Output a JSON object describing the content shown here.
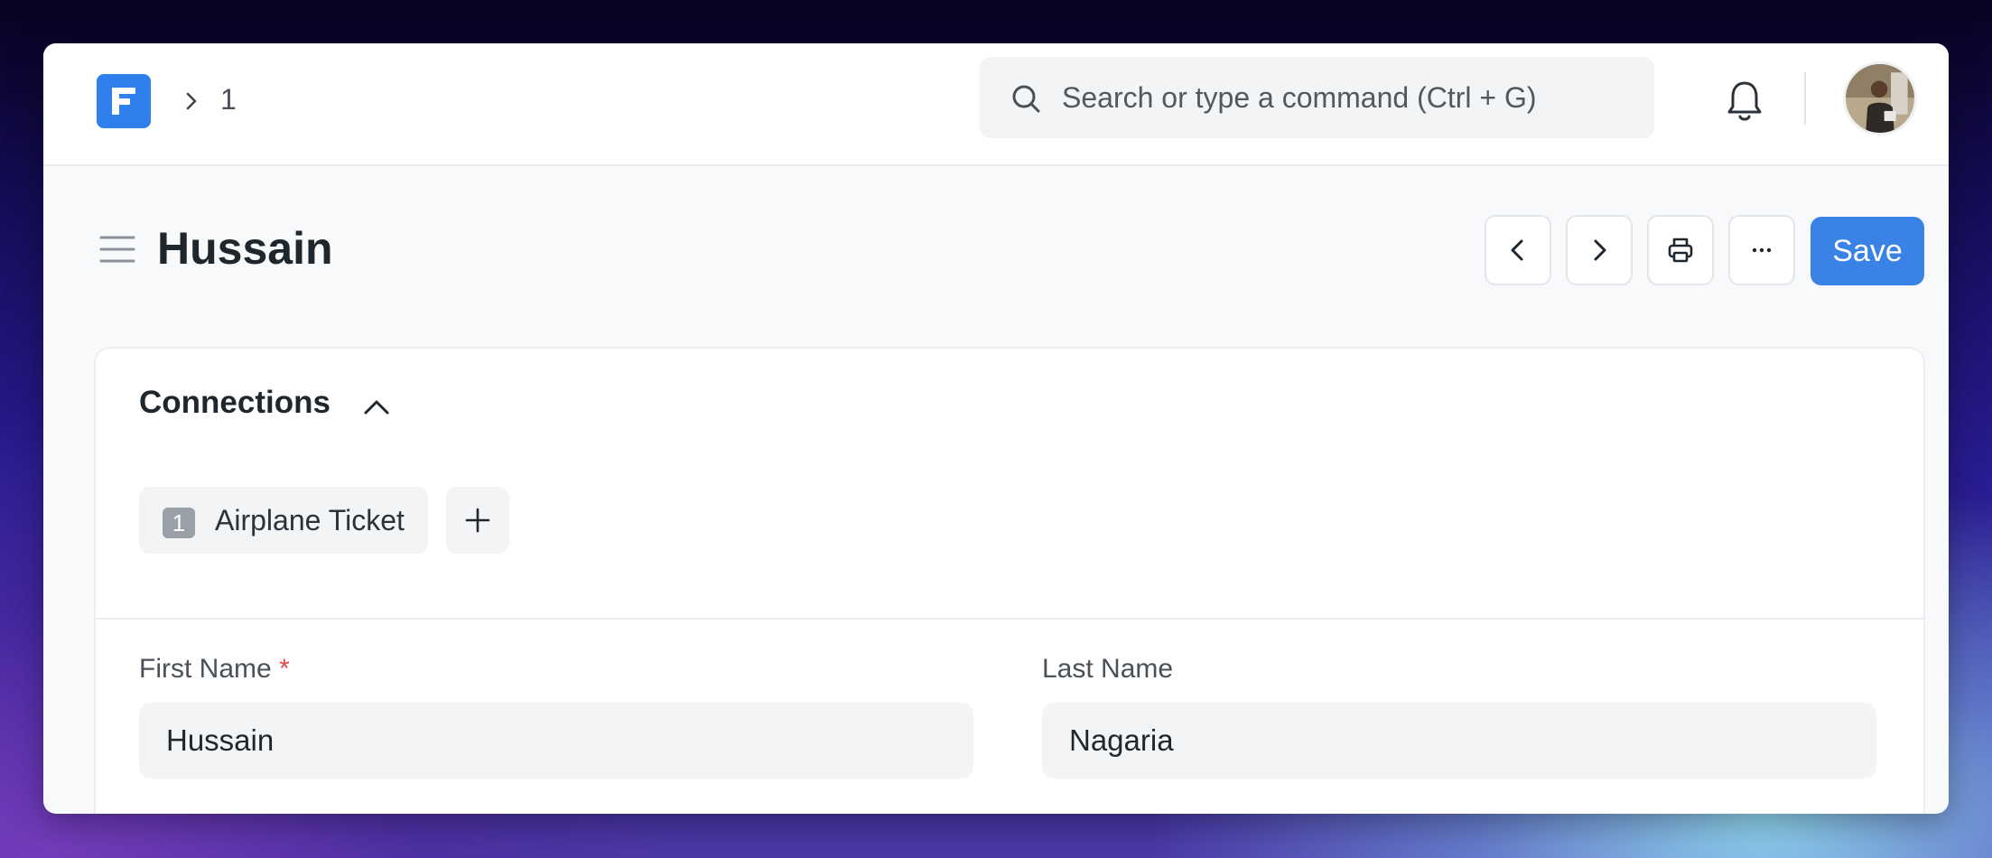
{
  "navbar": {
    "breadcrumb": "1",
    "search": {
      "placeholder": "Search or type a command (Ctrl + G)"
    },
    "icons": {
      "logo": "frappe-logo",
      "search": "search-icon",
      "notifications": "bell-icon",
      "avatar": "user-avatar"
    }
  },
  "page": {
    "title": "Hussain",
    "actions": {
      "prev_icon": "chevron-left-icon",
      "next_icon": "chevron-right-icon",
      "print_icon": "printer-icon",
      "more_icon": "ellipsis-icon",
      "save_label": "Save"
    }
  },
  "connections": {
    "title": "Connections",
    "items": [
      {
        "count": "1",
        "label": "Airplane Ticket"
      }
    ]
  },
  "form": {
    "first_name": {
      "label": "First Name",
      "required_mark": "*",
      "value": "Hussain"
    },
    "last_name": {
      "label": "Last Name",
      "value": "Nagaria"
    }
  },
  "colors": {
    "accent": "#3b82e6",
    "required": "#e24c4c",
    "logo": "#2f80ed"
  }
}
